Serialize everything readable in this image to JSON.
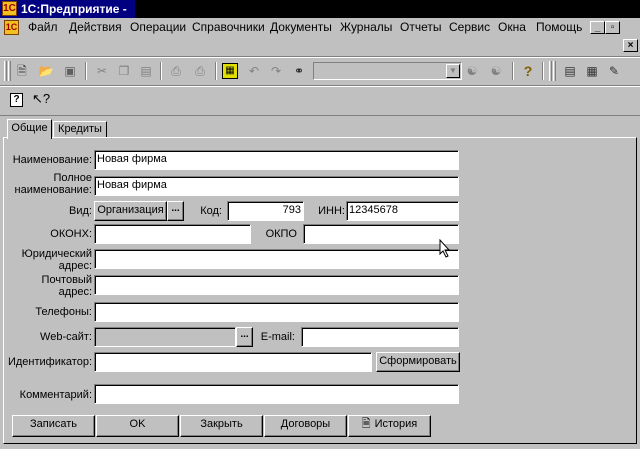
{
  "window": {
    "title": "1С:Предприятие -"
  },
  "menu": {
    "items": [
      {
        "label": "Файл",
        "u": "Ф"
      },
      {
        "label": "Действия",
        "u": ""
      },
      {
        "label": "Операции",
        "u": ""
      },
      {
        "label": "Справочники",
        "u": ""
      },
      {
        "label": "Документы",
        "u": ""
      },
      {
        "label": "Журналы",
        "u": ""
      },
      {
        "label": "Отчеты",
        "u": ""
      },
      {
        "label": "Сервис",
        "u": ""
      },
      {
        "label": "Окна",
        "u": ""
      },
      {
        "label": "Помощь",
        "u": ""
      }
    ],
    "minimize": "_",
    "restore": "▫",
    "close": "×"
  },
  "toolbar": {
    "icons": [
      "new-document-icon",
      "open-folder-icon",
      "save-icon",
      "cut-icon",
      "copy-icon",
      "paste-icon",
      "print-icon",
      "print-preview-icon",
      "calculator-icon",
      "undo-icon",
      "redo-icon",
      "find-icon",
      "find-in-list-icon",
      "find-in-column-icon",
      "help-icon",
      "calendar-icon",
      "notebook-icon",
      "edit-icon"
    ]
  },
  "tabs": [
    {
      "label": "Общие",
      "active": true
    },
    {
      "label": "Кредиты",
      "active": false
    }
  ],
  "form": {
    "name_label": "Наименование:",
    "name_value": "Новая фирма",
    "fullname_label_1": "Полное",
    "fullname_label_2": "наименование:",
    "fullname_value": "Новая фирма",
    "kind_label": "Вид:",
    "kind_button": "Организация",
    "kind_select": "...",
    "code_label": "Код:",
    "code_value": "793",
    "inn_label": "ИНН:",
    "inn_value": "12345678",
    "okonh_label": "ОКОНХ:",
    "okonh_value": "",
    "okpo_label": "ОКПО",
    "okpo_value": "",
    "legal_label_1": "Юридический",
    "legal_label_2": "адрес:",
    "legal_value": "",
    "postal_label_1": "Почтовый",
    "postal_label_2": "адрес:",
    "postal_value": "",
    "phones_label": "Телефоны:",
    "phones_value": "",
    "web_label": "Web-сайт:",
    "web_value": "",
    "web_select": "...",
    "email_label": "E-mail:",
    "email_value": "",
    "id_label": "Идентификатор:",
    "id_value": "",
    "generate_button": "Сформировать",
    "comment_label": "Комментарий:",
    "comment_value": ""
  },
  "buttons": {
    "save": "Записать",
    "ok": "OK",
    "close": "Закрыть",
    "contracts": "Договоры",
    "history": "История"
  },
  "colors": {
    "titlebar": "#000080",
    "face": "#c0c0c0"
  }
}
